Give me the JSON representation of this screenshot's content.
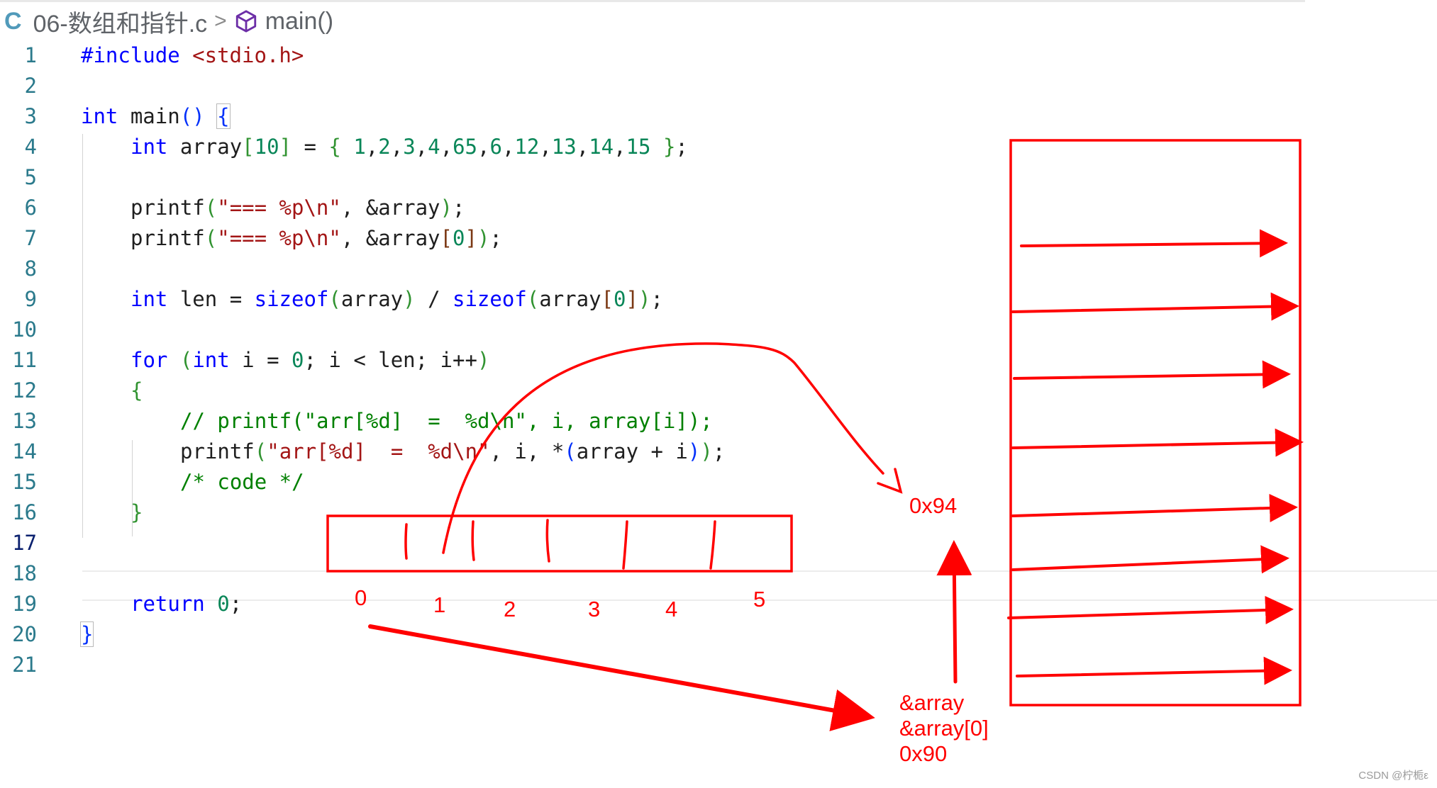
{
  "breadcrumb": {
    "lang_icon": "C",
    "file": "06-数组和指针.c",
    "separator": ">",
    "symbol_icon": "symbol-method-icon",
    "symbol": "main()"
  },
  "editor": {
    "active_line": 17,
    "lines": [
      {
        "n": "1"
      },
      {
        "n": "2"
      },
      {
        "n": "3"
      },
      {
        "n": "4"
      },
      {
        "n": "5"
      },
      {
        "n": "6"
      },
      {
        "n": "7"
      },
      {
        "n": "8"
      },
      {
        "n": "9"
      },
      {
        "n": "10"
      },
      {
        "n": "11"
      },
      {
        "n": "12"
      },
      {
        "n": "13"
      },
      {
        "n": "14"
      },
      {
        "n": "15"
      },
      {
        "n": "16"
      },
      {
        "n": "17"
      },
      {
        "n": "18"
      },
      {
        "n": "19"
      },
      {
        "n": "20"
      },
      {
        "n": "21"
      }
    ],
    "code": {
      "l1_directive": "#include",
      "l1_header": "<stdio.h>",
      "l3_type": "int",
      "l3_name": " main",
      "l3_parens": "()",
      "l3_brace": "{",
      "l4_type": "int",
      "l4_name": " array",
      "l4_size_open": "[",
      "l4_size": "10",
      "l4_size_close": "]",
      "l4_assign": " = ",
      "l4_open": "{ ",
      "l4_values": [
        "1",
        "2",
        "3",
        "4",
        "65",
        "6",
        "12",
        "13",
        "14",
        "15"
      ],
      "l4_close": " }",
      "l4_end": ";",
      "l6_fn": "printf",
      "l6_str": "\"=== %p\\n\"",
      "l6_args": ", &array",
      "l7_fn": "printf",
      "l7_str": "\"=== %p\\n\"",
      "l7_args": ", &array",
      "l7_idx": "0",
      "l9_type": "int",
      "l9_name": " len = ",
      "l9_sizeof1": "sizeof",
      "l9_arg1": "array",
      "l9_div": " / ",
      "l9_sizeof2": "sizeof",
      "l9_arg2": "array",
      "l9_idx": "0",
      "l11_for": "for",
      "l11_type": "int",
      "l11_init": " i = ",
      "l11_zero": "0",
      "l11_rest": "; i < len; i++",
      "l12_brace": "{",
      "l13_comment": "// printf(\"arr[%d]  =  %d\\n\", i, array[i]);",
      "l14_fn": "printf",
      "l14_str": "\"arr[%d]  =  %d\\n\"",
      "l14_args": ", i, *",
      "l14_expr": "array + i",
      "l15_comment": "/* code */",
      "l16_brace": "}",
      "l19_return": "return",
      "l19_zero": "0",
      "l20_brace": "}"
    }
  },
  "annotations": {
    "index_labels": [
      "0",
      "1",
      "2",
      "3",
      "4",
      "5"
    ],
    "address_top": "0x94",
    "address_block": [
      "&array",
      "&array[0]",
      "0x90"
    ],
    "ink_color": "#ff0000"
  },
  "watermark": "CSDN @柠栀ε"
}
